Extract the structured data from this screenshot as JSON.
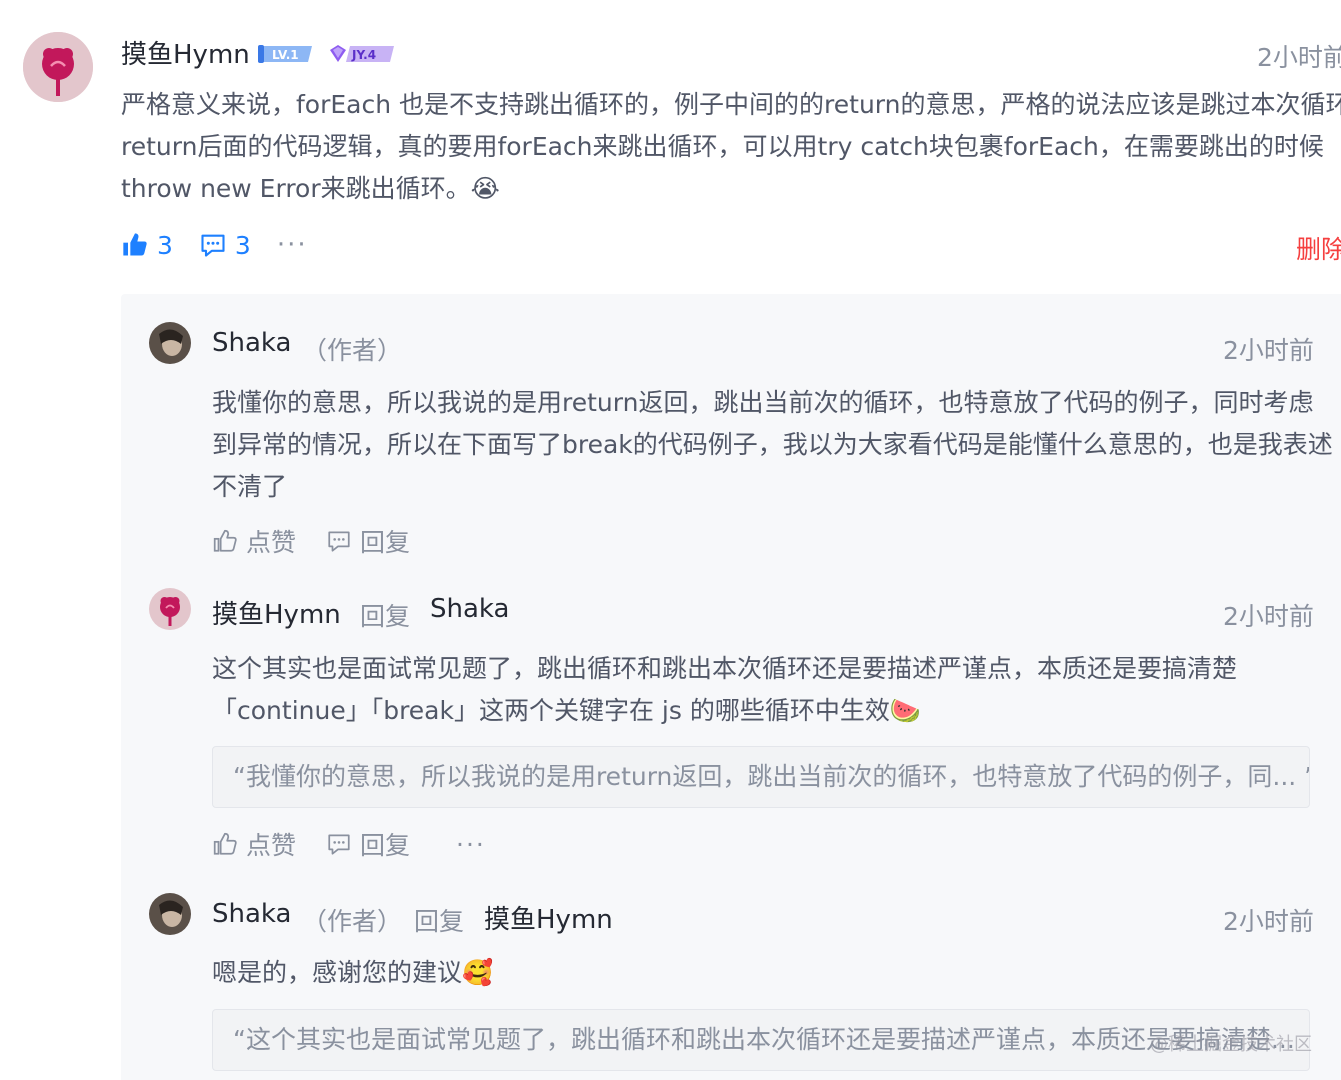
{
  "main_comment": {
    "username": "摸鱼Hymn",
    "badges": [
      "LV.1",
      "JY.4"
    ],
    "time": "2小时前",
    "text_lines": [
      "严格意义来说，forEach 也是不支持跳出循环的，例子中间的的return的意思，严格的说法应该是跳过本次循环的",
      "return后面的代码逻辑，真的要用forEach来跳出循环，可以用try catch块包裹forEach，在需要跳出的时候",
      "throw new Error来跳出循环。😭"
    ],
    "like_count": "3",
    "reply_count": "3",
    "more": "···",
    "delete_label": "删除"
  },
  "replies": [
    {
      "username": "Shaka",
      "author_tag": "（作者）",
      "time": "2小时前",
      "text_lines": [
        "我懂你的意思，所以我说的是用return返回，跳出当前次的循环，也特意放了代码的例子，同时考虑",
        "到异常的情况，所以在下面写了break的代码例子，我以为大家看代码是能懂什么意思的，也是我表述",
        "不清了"
      ],
      "like_label": "点赞",
      "reply_label": "回复"
    },
    {
      "username": "摸鱼Hymn",
      "reply_word": "回复",
      "reply_to": "Shaka",
      "time": "2小时前",
      "text_lines": [
        "这个其实也是面试常见题了，跳出循环和跳出本次循环还是要描述严谨点，本质还是要搞清楚",
        "「continue」「break」这两个关键字在 js 的哪些循环中生效🍉"
      ],
      "quote": "“我懂你的意思，所以我说的是用return返回，跳出当前次的循环，也特意放了代码的例子，同... ”",
      "like_label": "点赞",
      "reply_label": "回复",
      "more": "···"
    },
    {
      "username": "Shaka",
      "author_tag": "（作者）",
      "reply_word": "回复",
      "reply_to": "摸鱼Hymn",
      "time": "2小时前",
      "text": "嗯是的，感谢您的建议🥰",
      "quote": "“这个其实也是面试常见题了，跳出循环和跳出本次循环还是要描述严谨点，本质还是要搞清楚..."
    }
  ],
  "watermark": "@稀土掘金技术社区",
  "colors": {
    "accent": "#1e80ff",
    "danger": "#f53f3f",
    "muted": "#8a919f",
    "reply_bg": "#f7f8fa"
  }
}
